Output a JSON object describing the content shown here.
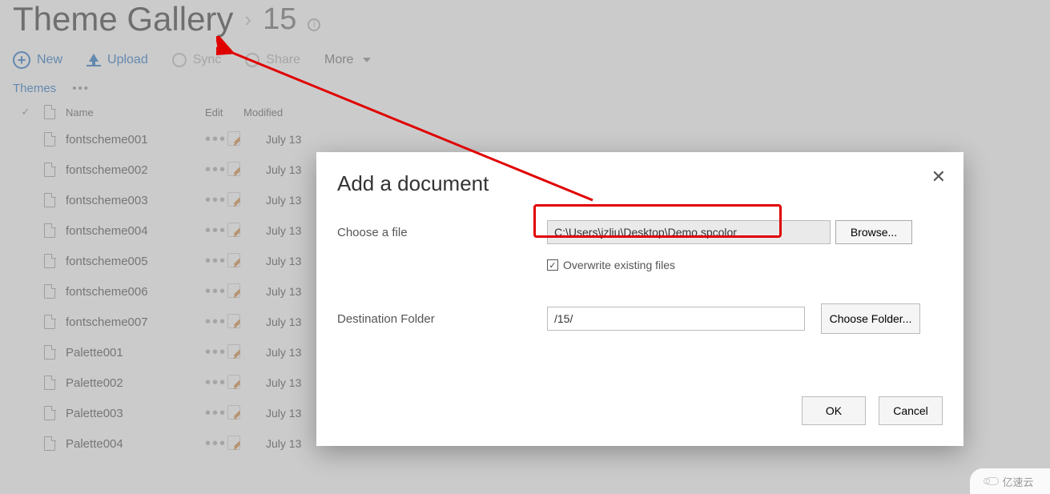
{
  "breadcrumb": {
    "main": "Theme Gallery",
    "sub": "15"
  },
  "toolbar": {
    "new_label": "New",
    "upload_label": "Upload",
    "sync_label": "Sync",
    "share_label": "Share",
    "more_label": "More"
  },
  "subnav": {
    "themes_label": "Themes"
  },
  "columns": {
    "name": "Name",
    "edit": "Edit",
    "modified": "Modified"
  },
  "rows": [
    {
      "name": "fontscheme001",
      "modified": "July 13"
    },
    {
      "name": "fontscheme002",
      "modified": "July 13"
    },
    {
      "name": "fontscheme003",
      "modified": "July 13"
    },
    {
      "name": "fontscheme004",
      "modified": "July 13"
    },
    {
      "name": "fontscheme005",
      "modified": "July 13"
    },
    {
      "name": "fontscheme006",
      "modified": "July 13"
    },
    {
      "name": "fontscheme007",
      "modified": "July 13"
    },
    {
      "name": "Palette001",
      "modified": "July 13"
    },
    {
      "name": "Palette002",
      "modified": "July 13"
    },
    {
      "name": "Palette003",
      "modified": "July 13"
    },
    {
      "name": "Palette004",
      "modified": "July 13"
    }
  ],
  "dialog": {
    "title": "Add a document",
    "choose_label": "Choose a file",
    "file_path": "C:\\Users\\jzliu\\Desktop\\Demo.spcolor",
    "browse_label": "Browse...",
    "overwrite_label": "Overwrite existing files",
    "dest_label": "Destination Folder",
    "dest_value": "/15/",
    "choose_folder_label": "Choose Folder...",
    "ok_label": "OK",
    "cancel_label": "Cancel"
  },
  "watermark": {
    "text": "亿速云"
  }
}
